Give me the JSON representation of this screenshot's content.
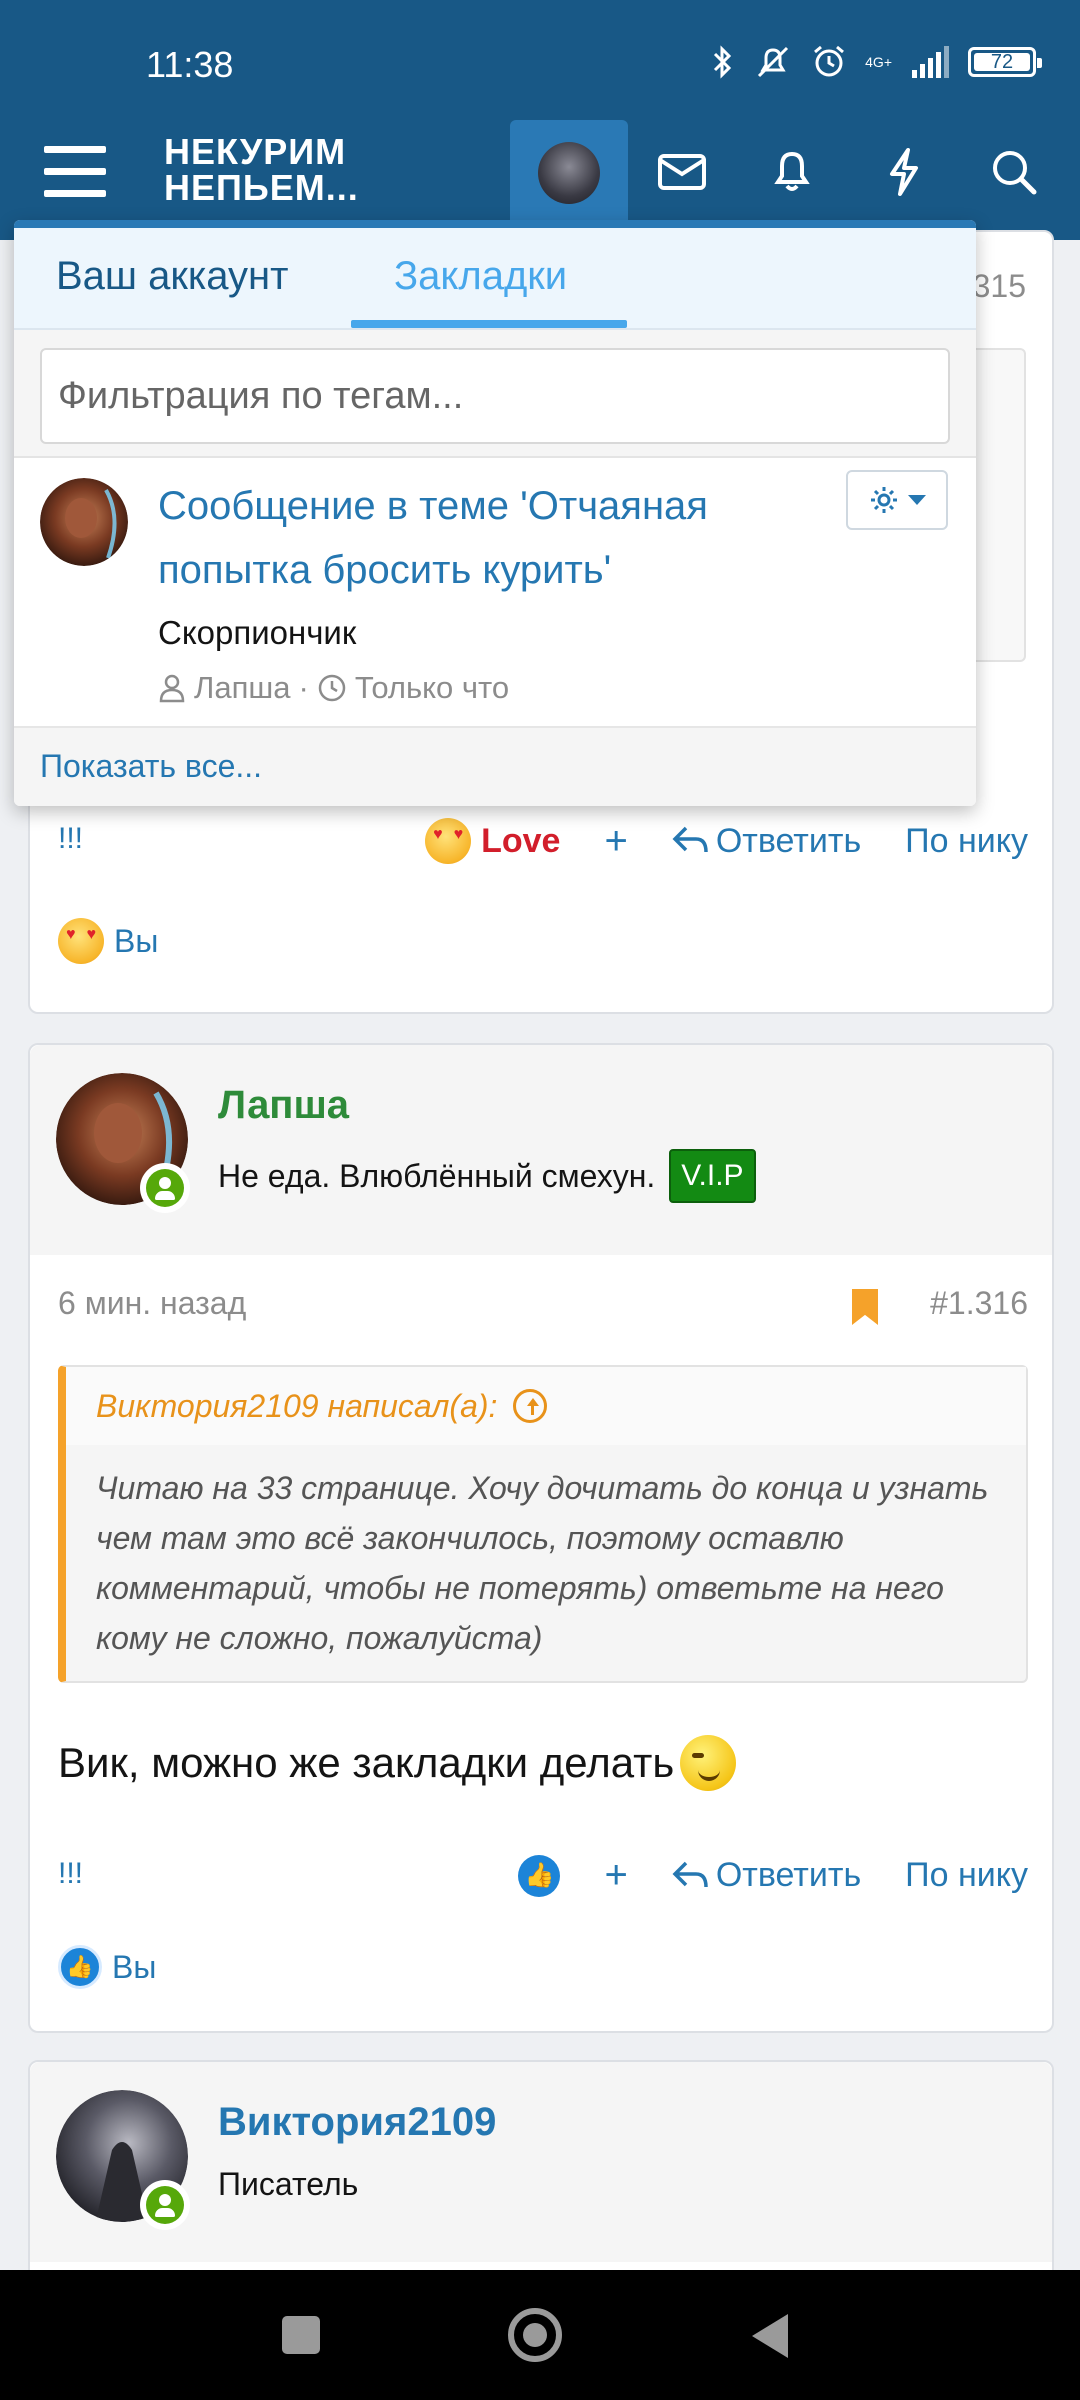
{
  "status_bar": {
    "time": "11:38",
    "network": "4G+",
    "battery": "72"
  },
  "header": {
    "logo_line1": "НЕКУРИМ",
    "logo_line2": "НЕПЬЕМ...",
    "icons": [
      "menu-icon",
      "avatar",
      "mail-icon",
      "bell-icon",
      "lightning-icon",
      "search-icon"
    ],
    "color": "#185886",
    "accent": "#2a79b5"
  },
  "popup": {
    "tabs": [
      "Ваш аккаунт",
      "Закладки"
    ],
    "active_tab": "Закладки",
    "filter_placeholder": "Фильтрация по тегам...",
    "bookmark": {
      "title": "Сообщение в теме 'Отчаяная попытка бросить курить'",
      "excerpt": "Скорпиончик",
      "author": "Лапша",
      "time": "Только что"
    },
    "show_all": "Показать все..."
  },
  "post1": {
    "number_fragment": "315",
    "excl": "!!!",
    "reaction": "Love",
    "reply": "Ответить",
    "by_nick": "По нику",
    "reactors": "Вы"
  },
  "post2": {
    "author": "Лапша",
    "author_color": "#2e8b3a",
    "user_title": "Не еда. Влюблённый смехун.",
    "badge": "V.I.P",
    "time": "6 мин. назад",
    "number": "#1.316",
    "quote_author": "Виктория2109 написал(а):",
    "quote_text": "Читаю на 33 странице. Хочу дочитать до конца и узнать чем там это всё закончилось, поэтому оставлю комментарий, чтобы не потерять) ответьте на него кому не сложно, пожалуйста)",
    "message": "Вик, можно же закладки делать",
    "excl": "!!!",
    "reply": "Ответить",
    "by_nick": "По нику",
    "reactors": "Вы"
  },
  "post3": {
    "author": "Виктория2109",
    "author_color": "#2577b1",
    "user_title": "Писатель"
  }
}
